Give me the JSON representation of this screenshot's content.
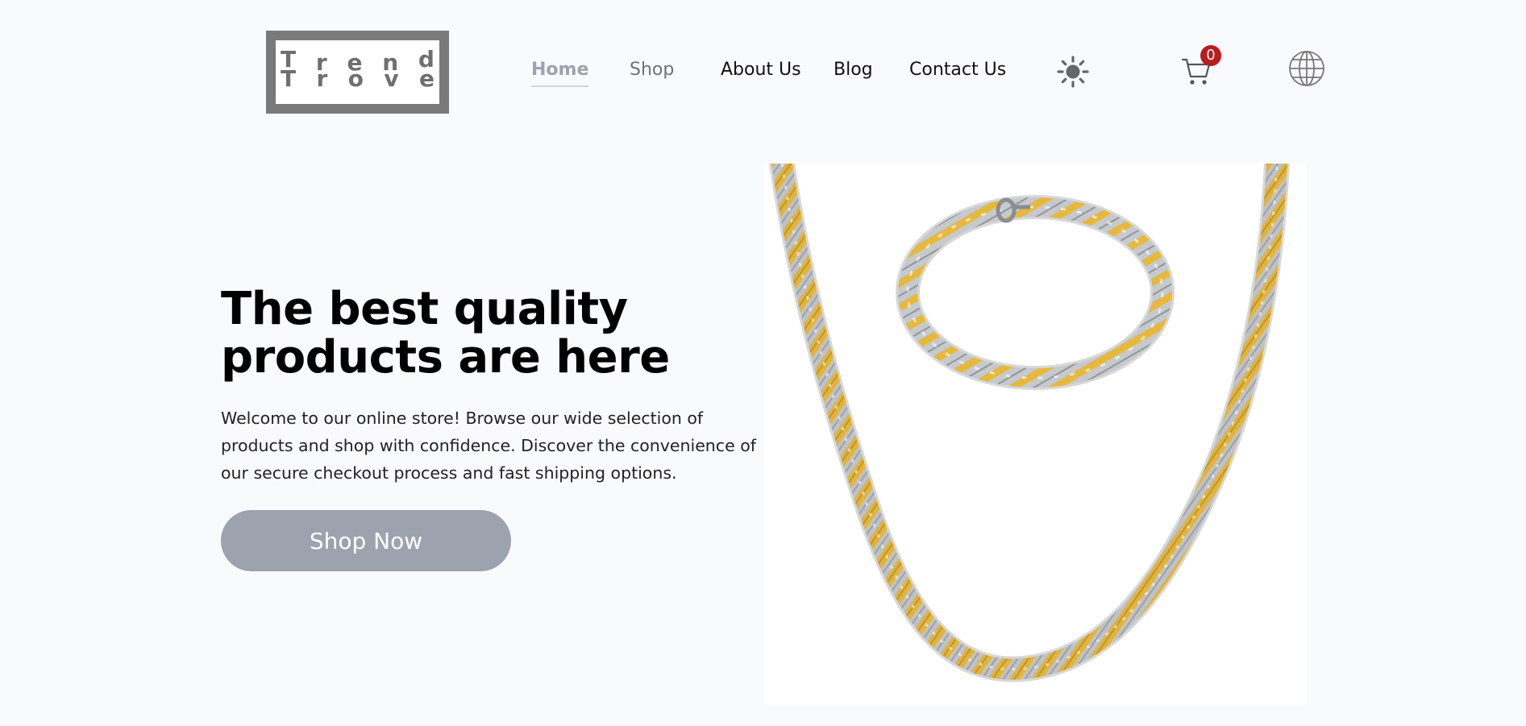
{
  "brand": {
    "logo_row1": [
      "T",
      "r",
      "e",
      "n",
      "d"
    ],
    "logo_row2": [
      "T",
      "r",
      "o",
      "v",
      "e"
    ]
  },
  "nav": {
    "items": [
      {
        "label": "Home",
        "active": true
      },
      {
        "label": "Shop"
      },
      {
        "label": "About Us"
      },
      {
        "label": "Blog"
      },
      {
        "label": "Contact Us"
      }
    ]
  },
  "header_icons": {
    "theme_toggle": "sun-icon",
    "cart": "cart-icon",
    "language": "globe-icon"
  },
  "cart": {
    "count": "0"
  },
  "hero": {
    "title": "The best quality products are here",
    "description": "Welcome to our online store! Browse our wide selection of products and shop with confidence. Discover the convenience of our secure checkout process and fast shipping options.",
    "cta_label": "Shop Now",
    "image_subject": "gold and silver chain necklace and bracelet"
  },
  "colors": {
    "background": "#f9fafb",
    "cta_background": "#9ca3af",
    "nav_active": "#9ca3af",
    "badge": "#b91c1c",
    "logo_gray": "#7a7a7a",
    "gold": "#e3b43a",
    "silver": "#b9bcc0"
  }
}
